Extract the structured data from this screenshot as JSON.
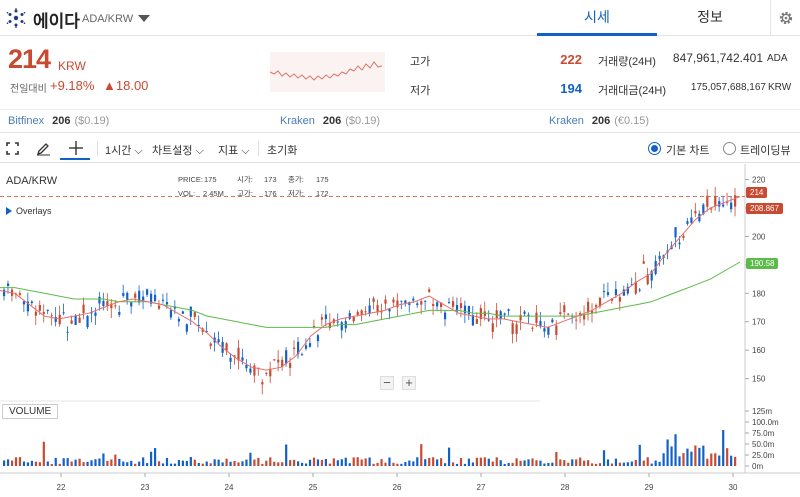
{
  "header": {
    "coin_name": "에이다",
    "symbol": "ADA/KRW",
    "tabs": [
      {
        "label": "시세",
        "active": true
      },
      {
        "label": "정보",
        "active": false
      }
    ]
  },
  "price": {
    "current": "214",
    "unit": "KRW",
    "change_label": "전일대비",
    "change_pct": "+9.18%",
    "change_abs": "▲18.00",
    "high_label": "고가",
    "high": "222",
    "low_label": "저가",
    "low": "194",
    "volume_label": "거래량(24H)",
    "volume": "847,961,742.401",
    "volume_unit": "ADA",
    "turnover_label": "거래대금(24H)",
    "turnover": "175,057,688,167",
    "turnover_unit": "KRW"
  },
  "exchanges": [
    {
      "name": "Bitfinex",
      "price": "206",
      "usd": "($0.19)"
    },
    {
      "name": "Kraken",
      "price": "206",
      "usd": "($0.19)"
    },
    {
      "name": "Kraken",
      "price": "206",
      "usd": "(€0.15)"
    }
  ],
  "toolbar": {
    "interval": "1시간",
    "settings": "차트설정",
    "indicators": "지표",
    "reset": "초기화",
    "basic_chart": "기본 차트",
    "tradingview": "트레이딩뷰"
  },
  "chart_labels": {
    "symbol": "ADA/KRW",
    "overlays": "Overlays",
    "volume": "VOLUME",
    "zoom_out": "−",
    "zoom_in": "+",
    "price_badge": "214",
    "ma_fast_badge": "208.867",
    "ma_slow_badge": "190.58"
  },
  "ohlc_readout": {
    "price_label": "PRICE:",
    "price": "175",
    "open_label": "시가:",
    "open": "173",
    "close_label": "종가:",
    "close": "175",
    "vol_label": "VOL:",
    "vol": "2.45M",
    "high_label": "고가:",
    "high": "176",
    "low_label": "저가:",
    "low": "172"
  },
  "colors": {
    "up": "#c84a31",
    "down": "#1261c4",
    "ma_fast": "#e8706a",
    "ma_slow": "#5dbb4a"
  },
  "chart_data": {
    "type": "line",
    "x": [
      "22",
      "23",
      "24",
      "25",
      "26",
      "27",
      "28",
      "29",
      "30"
    ],
    "price_axis": [
      150,
      160,
      170,
      180,
      190,
      200,
      210,
      220
    ],
    "volume_axis": [
      "125m",
      "100.0m",
      "75.0m",
      "50.0m",
      "25.0m",
      "0m"
    ],
    "ylim": [
      146,
      223
    ],
    "series": [
      {
        "values": [
          181,
          180,
          176,
          172,
          171,
          172,
          173,
          175,
          177,
          178,
          177,
          176,
          173,
          170,
          166,
          161,
          157,
          154,
          153,
          154,
          158,
          165,
          169,
          171,
          172,
          173,
          174,
          176,
          177,
          179,
          176,
          173,
          172,
          171,
          171,
          170,
          169,
          168,
          170,
          172,
          174,
          177,
          180,
          184,
          187,
          194,
          200,
          206,
          210,
          212,
          214
        ]
      },
      {
        "values": [
          182,
          182,
          181,
          180,
          179,
          178,
          178,
          178,
          177,
          177,
          177,
          176,
          175,
          174,
          172,
          171,
          170,
          169,
          168,
          168,
          168,
          168,
          168,
          169,
          169,
          170,
          171,
          172,
          173,
          174,
          174,
          174,
          173,
          173,
          172,
          172,
          172,
          172,
          172,
          172,
          173,
          174,
          175,
          176,
          177,
          179,
          181,
          183,
          185,
          188,
          191
        ]
      }
    ]
  }
}
